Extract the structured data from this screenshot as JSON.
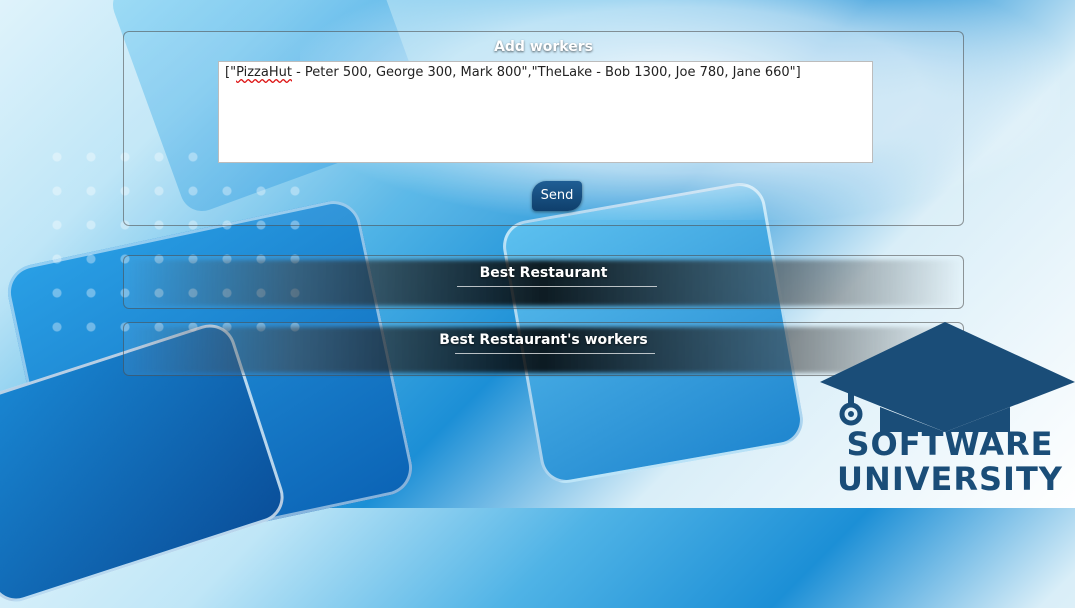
{
  "add_panel": {
    "title": "Add workers",
    "textarea_value_part1": "[\"",
    "textarea_value_misspelled": "PizzaHut",
    "textarea_value_part2": " - Peter 500, George 300, Mark 800\",\"TheLake - Bob 1300, Joe 780, Jane 660\"]",
    "send_label": "Send"
  },
  "best_restaurant": {
    "title": "Best Restaurant"
  },
  "best_workers": {
    "title": "Best Restaurant's workers"
  },
  "logo": {
    "line1": "SOFTWARE",
    "line2": "UNIVERSITY",
    "color": "#1a4d78"
  },
  "colors": {
    "send_button": "#1f5e94",
    "background_blue": "#1c8fd6"
  }
}
